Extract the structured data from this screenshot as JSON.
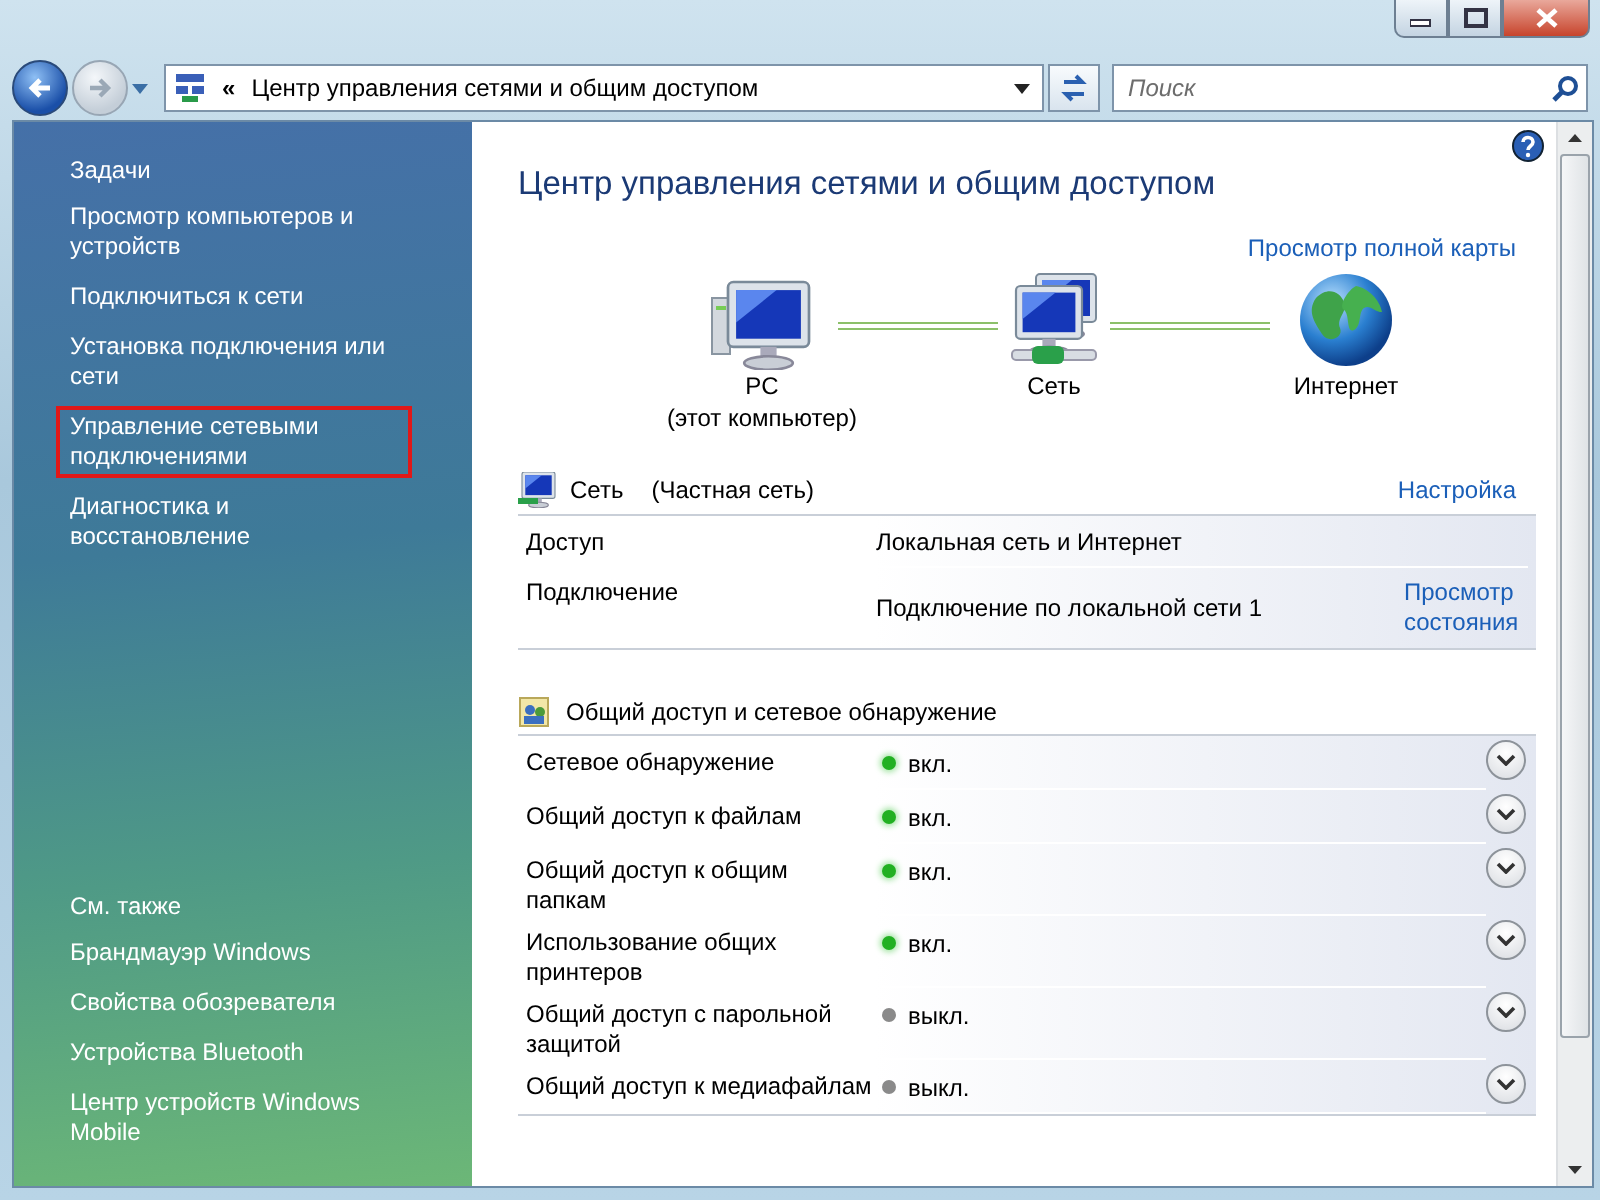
{
  "address_bar": {
    "chevron": "«",
    "path": "Центр управления сетями и общим доступом",
    "forward_enabled": false
  },
  "search": {
    "placeholder": "Поиск"
  },
  "sidebar": {
    "tasks_heading": "Задачи",
    "tasks": [
      {
        "label": "Просмотр компьютеров и устройств",
        "highlighted": false
      },
      {
        "label": "Подключиться к сети",
        "highlighted": false
      },
      {
        "label": "Установка подключения или сети",
        "highlighted": false
      },
      {
        "label": "Управление сетевыми подключениями",
        "highlighted": true
      },
      {
        "label": "Диагностика и восстановление",
        "highlighted": false
      }
    ],
    "see_also_heading": "См. также",
    "see_also": [
      "Брандмауэр Windows",
      "Свойства обозревателя",
      "Устройства Bluetooth",
      "Центр устройств Windows Mobile"
    ]
  },
  "content": {
    "title": "Центр управления сетями и общим доступом",
    "full_map_link": "Просмотр полной карты",
    "map": [
      {
        "kind": "computer",
        "label": "PC",
        "sublabel": "(этот компьютер)"
      },
      {
        "kind": "network",
        "label": "Сеть"
      },
      {
        "kind": "internet",
        "label": "Интернет"
      }
    ]
  },
  "network": {
    "name": "Сеть",
    "type": "(Частная сеть)",
    "customize_link": "Настройка",
    "rows": [
      {
        "label": "Доступ",
        "value": "Локальная сеть и Интернет"
      },
      {
        "label": "Подключение",
        "value": "Подключение по локальной сети 1",
        "link": "Просмотр состояния"
      }
    ]
  },
  "sharing": {
    "heading": "Общий доступ и сетевое обнаружение",
    "rows": [
      {
        "label": "Сетевое обнаружение",
        "on": true,
        "status": "вкл."
      },
      {
        "label": "Общий доступ к файлам",
        "on": true,
        "status": "вкл."
      },
      {
        "label": "Общий доступ к общим папкам",
        "on": true,
        "status": "вкл."
      },
      {
        "label": "Использование общих принтеров",
        "on": true,
        "status": "вкл."
      },
      {
        "label": "Общий доступ с парольной защитой",
        "on": false,
        "status": "выкл."
      },
      {
        "label": "Общий доступ к медиафайлам",
        "on": false,
        "status": "выкл."
      }
    ]
  }
}
